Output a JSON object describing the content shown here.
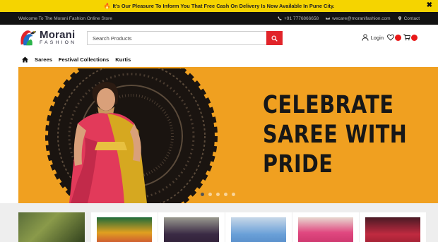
{
  "announcement": {
    "text": "It's Our Pleasure To Inform You That Free Cash On Delivery Is Now Available In Pune City."
  },
  "topbar": {
    "welcome": "Welcome To The Morani Fashion Online Store",
    "phone": "+91 7776866658",
    "email": "wecare@moranifashion.com",
    "contact": "Contact"
  },
  "header": {
    "brand_main": "Morani",
    "brand_sub": "FASHION",
    "search_placeholder": "Search Products",
    "login_label": "Login"
  },
  "nav": {
    "items": [
      "Sarees",
      "Festival Collections",
      "Kurtis"
    ]
  },
  "hero": {
    "headline_lines": [
      "CELEBRATE",
      "SAREE WITH",
      "PRIDE"
    ],
    "slide_count": 5,
    "active_slide": 1
  },
  "colors": {
    "accent_red": "#e1242a",
    "announcement_yellow": "#f5d400",
    "hero_orange": "#f0a020",
    "topbar_dark": "#121212"
  }
}
